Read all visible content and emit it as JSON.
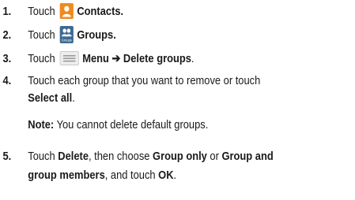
{
  "steps": [
    {
      "number": "1.",
      "parts": [
        "Touch",
        "Contacts."
      ],
      "icon": "contacts-icon"
    },
    {
      "number": "2.",
      "parts": [
        "Touch",
        "Groups."
      ],
      "icon": "groups-icon",
      "icon_label": "Groups"
    },
    {
      "number": "3.",
      "parts": [
        "Touch",
        "Menu ➔ Delete groups",
        "."
      ],
      "icon": "menu-icon"
    },
    {
      "number": "4.",
      "lines": [
        "Touch each group that you want to remove or touch",
        "Select all",
        "."
      ],
      "note_label": "Note:",
      "note_text": " You cannot delete default groups."
    },
    {
      "number": "5.",
      "parts": [
        "Touch ",
        "Delete",
        ", then choose ",
        "Group only",
        " or ",
        "Group and",
        "group members",
        ", and touch ",
        "OK",
        "."
      ]
    }
  ],
  "colors": {
    "contacts_icon": "#f08a1c",
    "groups_icon": "#3d6a93",
    "menu_icon": "#eeeeee"
  }
}
